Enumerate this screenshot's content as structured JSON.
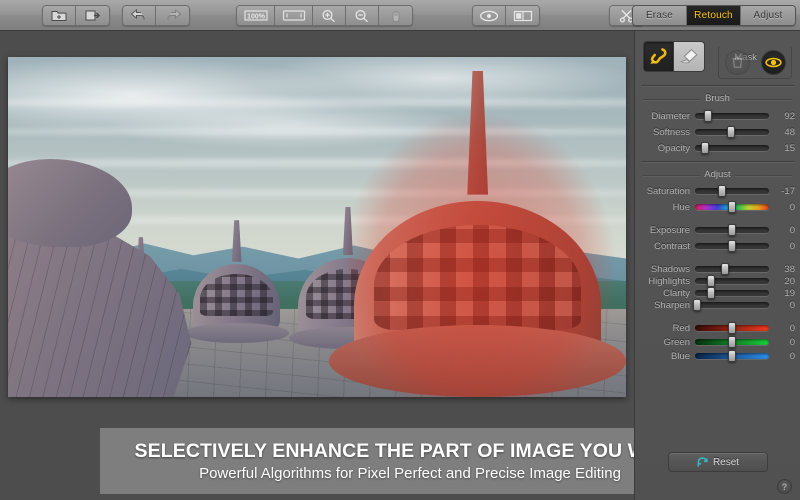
{
  "toolbar": {
    "left_group": [
      {
        "name": "open-folder-icon",
        "label": "Open"
      },
      {
        "name": "export-icon",
        "label": "Export"
      }
    ],
    "history_group": [
      {
        "name": "undo-icon",
        "label": "Undo"
      },
      {
        "name": "redo-icon",
        "label": "Redo"
      }
    ],
    "zoom_group": [
      {
        "name": "zoom-100-icon",
        "label": "100%"
      },
      {
        "name": "fit-screen-icon",
        "label": "Fit to Screen"
      },
      {
        "name": "zoom-in-icon",
        "label": "Zoom In"
      },
      {
        "name": "zoom-out-icon",
        "label": "Zoom Out"
      },
      {
        "name": "hand-tool-icon",
        "label": "Pan"
      }
    ],
    "view_group": [
      {
        "name": "preview-eye-icon",
        "label": "Preview"
      },
      {
        "name": "compare-split-icon",
        "label": "Compare"
      }
    ],
    "crop_group": [
      {
        "name": "crop-scissors-icon",
        "label": "Crop"
      }
    ]
  },
  "mode_tabs": {
    "items": [
      {
        "label": "Erase",
        "active": false
      },
      {
        "label": "Retouch",
        "active": true
      },
      {
        "label": "Adjust",
        "active": false
      }
    ],
    "active_color": "#ffc40a"
  },
  "panel": {
    "tools": [
      {
        "name": "brush-tool-icon",
        "label": "Brush",
        "active": true
      },
      {
        "name": "eraser-tool-icon",
        "label": "Eraser",
        "active": false
      }
    ],
    "mask": {
      "label": "Mask",
      "buttons": [
        {
          "name": "mask-delete-icon",
          "label": "Delete Mask",
          "enabled": false
        },
        {
          "name": "mask-visibility-icon",
          "label": "Show Mask",
          "enabled": true
        }
      ]
    },
    "brush": {
      "heading": "Brush",
      "sliders": [
        {
          "label": "Diameter",
          "value": "92",
          "pos": 18
        },
        {
          "label": "Softness",
          "value": "48",
          "pos": 48
        },
        {
          "label": "Opacity",
          "value": "15",
          "pos": 13
        }
      ]
    },
    "adjust": {
      "heading": "Adjust",
      "group1": [
        {
          "label": "Saturation",
          "value": "-17",
          "pos": 36,
          "track": ""
        },
        {
          "label": "Hue",
          "value": "0",
          "pos": 50,
          "track": "hue"
        }
      ],
      "group2": [
        {
          "label": "Exposure",
          "value": "0",
          "pos": 50,
          "track": ""
        },
        {
          "label": "Contrast",
          "value": "0",
          "pos": 50,
          "track": ""
        }
      ],
      "group3": [
        {
          "label": "Shadows",
          "value": "38",
          "pos": 40,
          "track": ""
        },
        {
          "label": "Highlights",
          "value": "20",
          "pos": 22,
          "track": ""
        },
        {
          "label": "Clarity",
          "value": "19",
          "pos": 21,
          "track": ""
        },
        {
          "label": "Sharpen",
          "value": "0",
          "pos": 3,
          "track": ""
        }
      ],
      "group4": [
        {
          "label": "Red",
          "value": "0",
          "pos": 50,
          "track": "red"
        },
        {
          "label": "Green",
          "value": "0",
          "pos": 50,
          "track": "green"
        },
        {
          "label": "Blue",
          "value": "0",
          "pos": 50,
          "track": "blue"
        }
      ]
    },
    "reset": {
      "label": "Reset",
      "icon": "refresh-icon",
      "color": "#2fb8c4"
    },
    "help": {
      "label": "?"
    }
  },
  "caption": {
    "title": "SELECTIVELY ENHANCE THE PART OF IMAGE YOU WANT",
    "subtitle": "Powerful Algorithms for Pixel Perfect and Precise Image Editing"
  },
  "canvas": {
    "photo_alt": "Borobudur temple stupas with red retouch mask overlay",
    "mask_color": "#d63424"
  }
}
